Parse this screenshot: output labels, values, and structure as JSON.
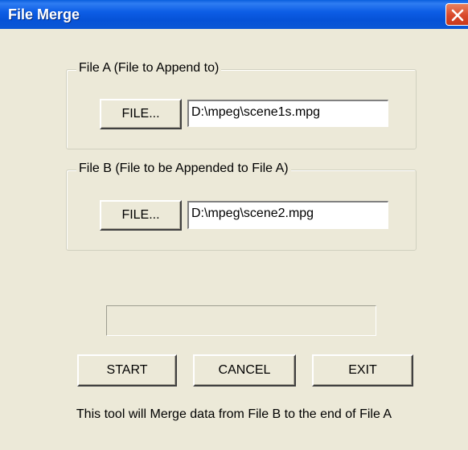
{
  "window": {
    "title": "File Merge",
    "close_icon": "close-icon",
    "titlebar_color": "#0b57d6",
    "close_color": "#d9482a",
    "body_color": "#ece9d8"
  },
  "file_a": {
    "group_label": "File A (File to Append to)",
    "button_label": "FILE...",
    "path": "D:\\mpeg\\scene1s.mpg"
  },
  "file_b": {
    "group_label": "File B (File to be Appended to File A)",
    "button_label": "FILE...",
    "path": "D:\\mpeg\\scene2.mpg"
  },
  "progress": {
    "value": 0
  },
  "actions": {
    "start_label": "START",
    "cancel_label": "CANCEL",
    "exit_label": "EXIT"
  },
  "info_text": "This tool will Merge data from File B to the end of File A"
}
